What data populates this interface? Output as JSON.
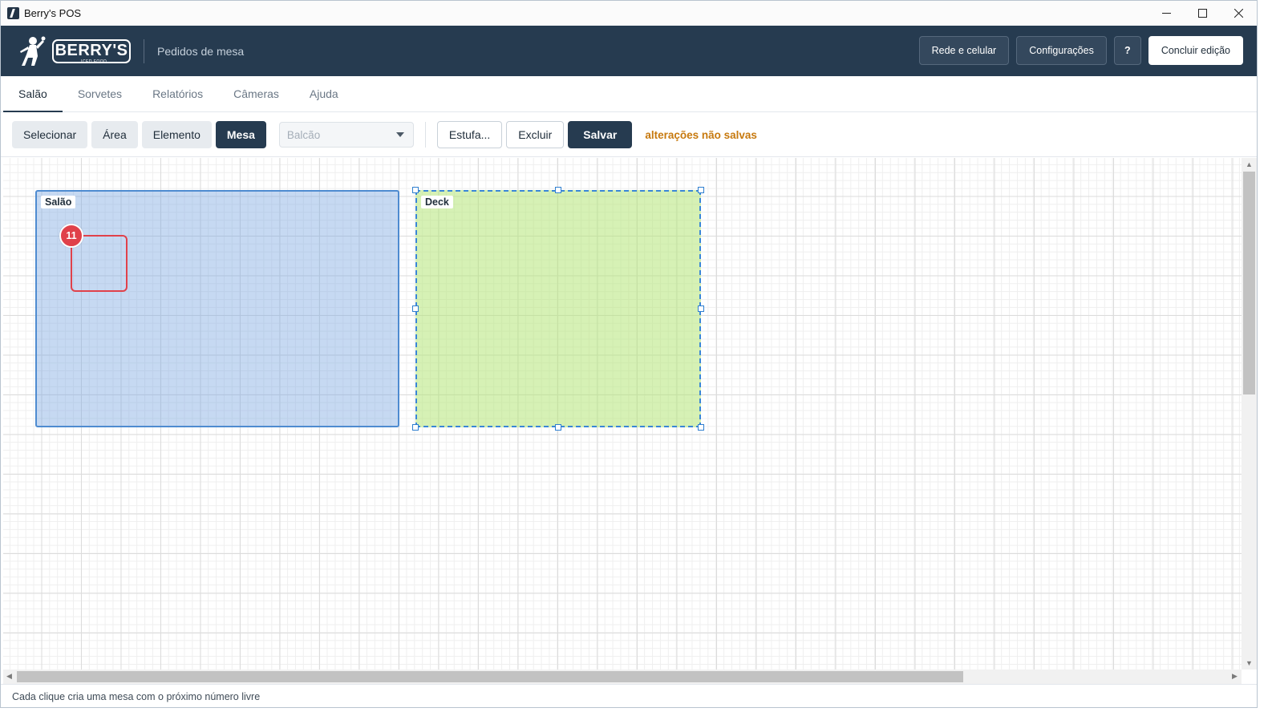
{
  "window": {
    "title": "Berry's POS"
  },
  "header": {
    "logo_text": "BERRY'S",
    "logo_sub": "ICED FOOD",
    "subtitle": "Pedidos de mesa",
    "actions": {
      "network": "Rede e celular",
      "settings": "Configurações",
      "help": "?",
      "finish": "Concluir edição"
    }
  },
  "tabs": [
    {
      "label": "Salão",
      "active": true
    },
    {
      "label": "Sorvetes"
    },
    {
      "label": "Relatórios"
    },
    {
      "label": "Câmeras"
    },
    {
      "label": "Ajuda"
    }
  ],
  "toolbar": {
    "select": "Selecionar",
    "area": "Área",
    "element": "Elemento",
    "table": "Mesa",
    "element_type_placeholder": "Balcão",
    "estufa": "Estufa...",
    "delete": "Excluir",
    "save": "Salvar",
    "unsaved": "alterações não salvas"
  },
  "canvas": {
    "areas": [
      {
        "label": "Salão",
        "color": "#78a5e1"
      },
      {
        "label": "Deck",
        "color": "#b4e678",
        "selected": true
      }
    ],
    "tables": [
      {
        "number": "11",
        "area": "Salão"
      }
    ]
  },
  "status": {
    "hint": "Cada clique cria uma mesa com o próximo número livre"
  },
  "colors": {
    "header_bg": "#263b50",
    "accent": "#263b50",
    "unsaved": "#c7790e",
    "table_border": "#e0414a"
  }
}
